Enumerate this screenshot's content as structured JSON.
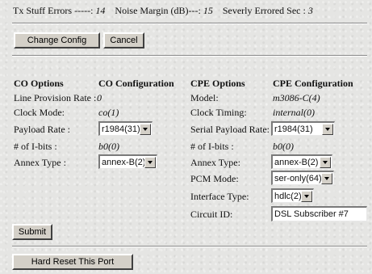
{
  "stats": {
    "tx_stuff_errors_label": "Tx Stuff Errors -----:",
    "tx_stuff_errors_value": "14",
    "noise_margin_label": "Noise Margin (dB)---:",
    "noise_margin_value": "15",
    "severly_errored_label": "Severly Errored Sec :",
    "severly_errored_value": "3"
  },
  "toolbar": {
    "change_config_label": "Change Config",
    "cancel_label": "Cancel"
  },
  "co": {
    "options_header": "CO Options",
    "config_header": "CO Configuration",
    "line_rate_label": "Line Provision Rate :",
    "line_rate_value": "0",
    "clock_mode_label": "Clock Mode:",
    "clock_mode_value": "co(1)",
    "payload_rate_label": "Payload Rate :",
    "payload_rate_value": "r1984(31)",
    "ibits_label": "# of I-bits :",
    "ibits_value": "b0(0)",
    "annex_type_label": "Annex Type :",
    "annex_type_value": "annex-B(2)"
  },
  "cpe": {
    "options_header": "CPE Options",
    "config_header": "CPE Configuration",
    "model_label": "Model:",
    "model_value": "m3086-C(4)",
    "clock_timing_label": "Clock Timing:",
    "clock_timing_value": "internal(0)",
    "serial_payload_label": "Serial Payload Rate:",
    "serial_payload_value": "r1984(31)",
    "ibits_label": "# of I-bits :",
    "ibits_value": "b0(0)",
    "annex_type_label": "Annex Type:",
    "annex_type_value": "annex-B(2)",
    "pcm_mode_label": "PCM Mode:",
    "pcm_mode_value": "ser-only(64)",
    "interface_type_label": "Interface Type:",
    "interface_type_value": "hdlc(2)",
    "circuit_id_label": "Circuit ID:",
    "circuit_id_value": "DSL Subscriber #7"
  },
  "actions": {
    "submit_label": "Submit",
    "hard_reset_label": "Hard Reset This Port"
  }
}
